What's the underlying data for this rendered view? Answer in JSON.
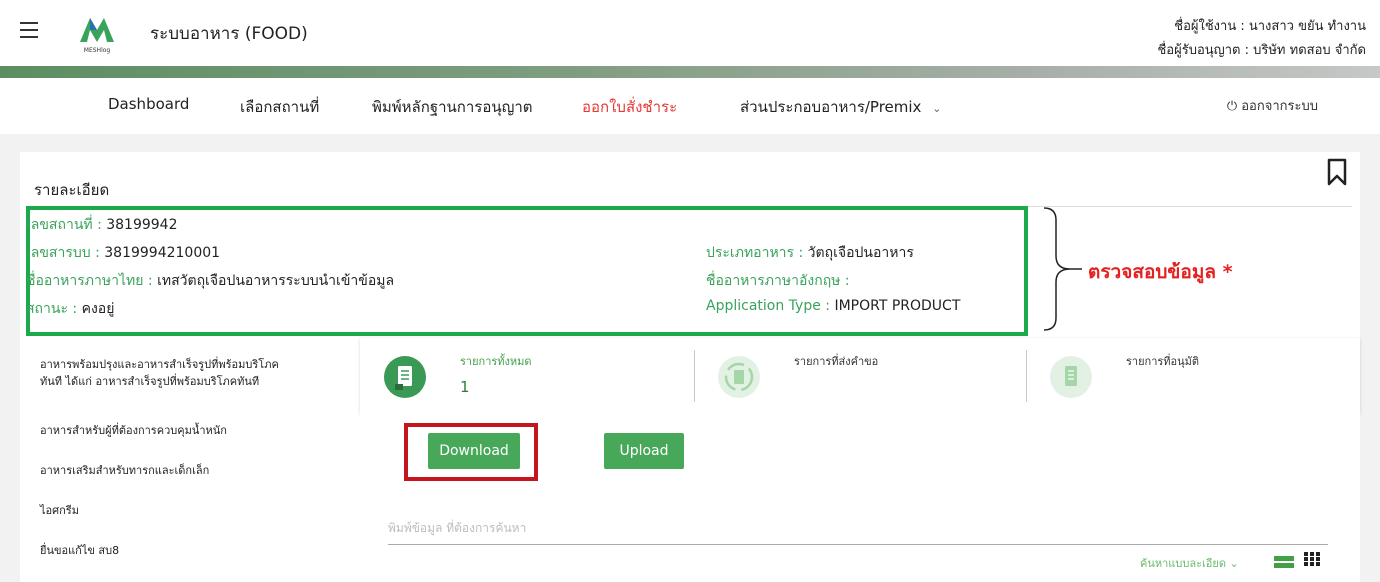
{
  "header": {
    "app_title": "ระบบอาหาร (FOOD)",
    "logo_text": "MESHlog",
    "user_line": "ชื่อผู้ใช้งาน : นางสาว ขยัน ทำงาน",
    "licensee_line": "ชื่อผู้รับอนุญาต : บริษัท ทดสอบ จำกัด"
  },
  "nav": {
    "items": [
      {
        "label": "Dashboard"
      },
      {
        "label": "เลือกสถานที่"
      },
      {
        "label": "พิมพ์หลักฐานการอนุญาต"
      },
      {
        "label": "ออกใบสั่งชำระ"
      },
      {
        "label": "ส่วนประกอบอาหาร/Premix"
      }
    ],
    "dropdown_arrow": "⌄",
    "logout_icon": "⏻",
    "logout_label": "ออกจากระบบ"
  },
  "detail": {
    "title": "รายละเอียด",
    "place_no_label": "เลขสถานที่ : ",
    "place_no": "38199942",
    "product_no_label": "เลขสารบบ : ",
    "product_no": "3819994210001",
    "thai_name_label": "ชื่ออาหารภาษาไทย : ",
    "thai_name": "เทสวัตถุเจือปนอาหารระบบนำเข้าข้อมูล",
    "status_label": "สถานะ : ",
    "status": "คงอยู่",
    "food_type_label": "ประเภทอาหาร : ",
    "food_type": "วัตถุเจือปนอาหาร",
    "eng_name_label": "ชื่ออาหารภาษาอังกฤษ : ",
    "eng_name": "",
    "app_type_label": "Application Type : ",
    "app_type": "IMPORT PRODUCT",
    "check_note": "ตรวจสอบข้อมูล *"
  },
  "left_menu": [
    {
      "label": "อาหารพร้อมปรุงและอาหารสำเร็จรูปที่พร้อมบริโภค"
    },
    {
      "label": "ทันที ได้แก่ อาหารสำเร็จรูปที่พร้อมบริโภคทันที"
    },
    {
      "label": "อาหารสำหรับผู้ที่ต้องการควบคุมน้ำหนัก"
    },
    {
      "label": "อาหารเสริมสำหรับทารกและเด็กเล็ก"
    },
    {
      "label": "ไอศกรีม"
    },
    {
      "label": "ยื่นขอแก้ไข สบ8"
    }
  ],
  "stats": [
    {
      "label": "รายการทั้งหมด",
      "count": "1"
    },
    {
      "label": "รายการที่ส่งคำขอ"
    },
    {
      "label": "รายการที่อนุมัติ"
    }
  ],
  "actions": {
    "download_label": "Download",
    "upload_label": "Upload"
  },
  "search": {
    "placeholder": "พิมพ์ข้อมูล ที่ต้องการค้นหา",
    "advanced_label": "ค้นหาแบบละเอียด ⌄"
  },
  "colors": {
    "accent_green": "#48a85a",
    "highlight_green": "#1aa94b",
    "highlight_red": "#c4161c",
    "active_nav": "#e53935"
  }
}
